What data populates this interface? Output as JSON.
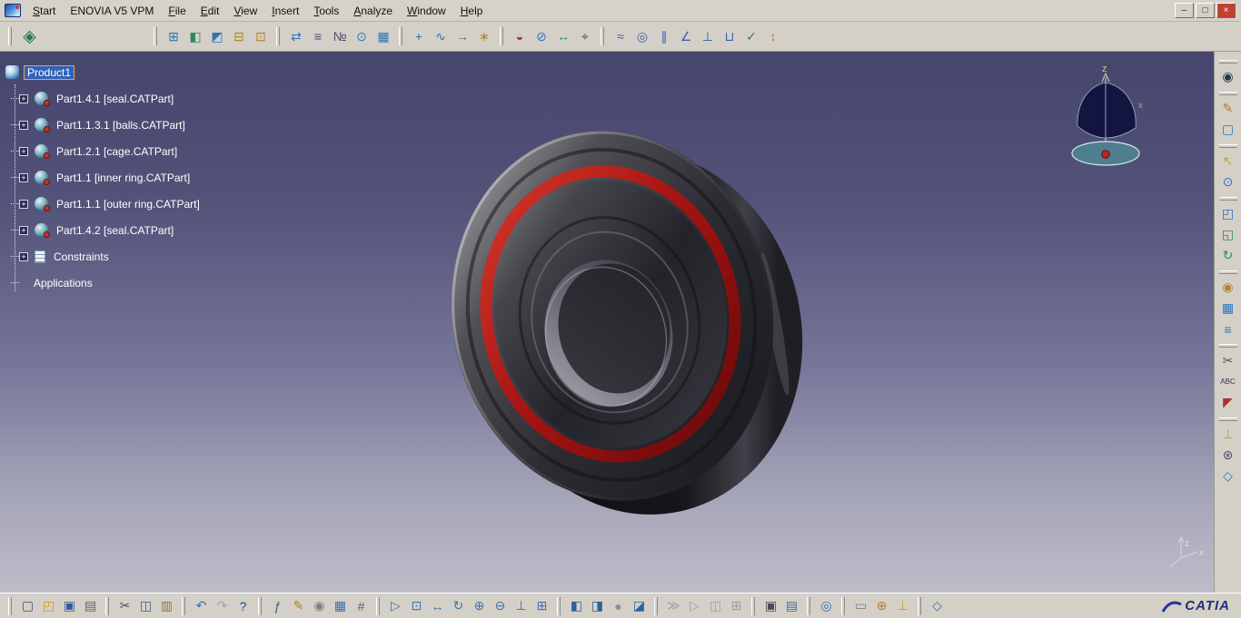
{
  "menubar": {
    "menus": [
      {
        "label": "Start",
        "u": 0
      },
      {
        "label": "ENOVIA V5 VPM",
        "u": -1
      },
      {
        "label": "File",
        "u": 0
      },
      {
        "label": "Edit",
        "u": 0
      },
      {
        "label": "View",
        "u": 0
      },
      {
        "label": "Insert",
        "u": 0
      },
      {
        "label": "Tools",
        "u": 0
      },
      {
        "label": "Analyze",
        "u": 0
      },
      {
        "label": "Window",
        "u": 0
      },
      {
        "label": "Help",
        "u": 0
      }
    ],
    "controls": [
      {
        "name": "minimize",
        "glyph": "–"
      },
      {
        "name": "restore",
        "glyph": "□"
      },
      {
        "name": "close",
        "glyph": "×"
      }
    ]
  },
  "toolbars": {
    "top": {
      "workbench": {
        "name": "assembly-design-workbench",
        "glyph": "◈",
        "color": "#2b7a4f"
      },
      "groups": [
        {
          "icons": [
            {
              "name": "new-component",
              "glyph": "⊞",
              "color": "#2e74b8"
            },
            {
              "name": "new-product",
              "glyph": "◧",
              "color": "#2e8b57"
            },
            {
              "name": "new-part",
              "glyph": "◩",
              "color": "#2e74b8"
            },
            {
              "name": "existing-component",
              "glyph": "⊟",
              "color": "#b5832a"
            },
            {
              "name": "existing-component-positioned",
              "glyph": "⊡",
              "color": "#b5832a"
            }
          ]
        },
        {
          "icons": [
            {
              "name": "replace-component",
              "glyph": "⇄",
              "color": "#2e74b8"
            },
            {
              "name": "graph-tree-reordering",
              "glyph": "≡",
              "color": "#44506a"
            },
            {
              "name": "generate-numbering",
              "glyph": "№",
              "color": "#44506a"
            },
            {
              "name": "selective-load",
              "glyph": "⊙",
              "color": "#2e74b8"
            },
            {
              "name": "manage-representations",
              "glyph": "▦",
              "color": "#2e74b8"
            }
          ]
        },
        {
          "icons": [
            {
              "name": "manipulation",
              "glyph": "+",
              "color": "#2e74b8"
            },
            {
              "name": "snap",
              "glyph": "∿",
              "color": "#2e74b8"
            },
            {
              "name": "smart-move",
              "glyph": "→",
              "color": "#2e8b57"
            },
            {
              "name": "explode",
              "glyph": "∗",
              "color": "#b5832a"
            }
          ]
        },
        {
          "icons": [
            {
              "name": "clash-analysis",
              "glyph": "◒",
              "color": "#b03030"
            },
            {
              "name": "sectioning",
              "glyph": "⊘",
              "color": "#2e74b8"
            },
            {
              "name": "distance-band-analysis",
              "glyph": "↔",
              "color": "#2e8b57"
            },
            {
              "name": "measure-between",
              "glyph": "⌖",
              "color": "#44506a"
            }
          ]
        },
        {
          "icons": [
            {
              "name": "coincidence-constraint",
              "glyph": "≈",
              "color": "#3a62a8"
            },
            {
              "name": "contact-constraint",
              "glyph": "◎",
              "color": "#3a62a8"
            },
            {
              "name": "offset-constraint",
              "glyph": "∥",
              "color": "#3a62a8"
            },
            {
              "name": "angle-constraint",
              "glyph": "∠",
              "color": "#3a62a8"
            },
            {
              "name": "fix-component",
              "glyph": "⊥",
              "color": "#3a62a8"
            },
            {
              "name": "fix-together",
              "glyph": "⊔",
              "color": "#3a62a8"
            },
            {
              "name": "quick-constraint",
              "glyph": "✓",
              "color": "#2e8b57"
            },
            {
              "name": "flexible-rigid-subassembly",
              "glyph": "↕",
              "color": "#b5832a"
            }
          ]
        }
      ]
    },
    "right": {
      "groups": [
        {
          "icons": [
            {
              "name": "examine-mode",
              "glyph": "◉",
              "color": "#27364a"
            }
          ]
        },
        {
          "icons": [
            {
              "name": "sketcher",
              "glyph": "✎",
              "color": "#b08020"
            },
            {
              "name": "new-sheet",
              "glyph": "▢",
              "color": "#2e74b8"
            }
          ]
        },
        {
          "icons": [
            {
              "name": "select",
              "glyph": "↖",
              "color": "#c8a020"
            },
            {
              "name": "zoom-part",
              "glyph": "⊙",
              "color": "#2e74b8"
            }
          ]
        },
        {
          "icons": [
            {
              "name": "open-in-new-window",
              "glyph": "◰",
              "color": "#2e74b8"
            },
            {
              "name": "publish",
              "glyph": "◱",
              "color": "#2e8b57"
            },
            {
              "name": "update-assembly",
              "glyph": "↻",
              "color": "#2e8b57"
            }
          ]
        },
        {
          "icons": [
            {
              "name": "manikin",
              "glyph": "◉",
              "color": "#b5832a"
            },
            {
              "name": "edit-table",
              "glyph": "▦",
              "color": "#2e74b8"
            },
            {
              "name": "edit-list",
              "glyph": "≡",
              "color": "#2e74b8"
            }
          ]
        },
        {
          "icons": [
            {
              "name": "section-cut",
              "glyph": "✂",
              "color": "#4a5668"
            },
            {
              "name": "text-annotation",
              "glyph": "ABC",
              "color": "#2f3e52"
            },
            {
              "name": "flag-note",
              "glyph": "◤",
              "color": "#b03030"
            }
          ]
        },
        {
          "icons": [
            {
              "name": "axis-system",
              "glyph": "⊥",
              "color": "#c8a020"
            },
            {
              "name": "tools-palette",
              "glyph": "⊛",
              "color": "#44506a"
            },
            {
              "name": "catalog",
              "glyph": "◇",
              "color": "#2e74b8"
            }
          ]
        }
      ]
    },
    "bottom": {
      "groups": [
        {
          "icons": [
            {
              "name": "new-document",
              "glyph": "▢",
              "color": "#3b4e6b"
            },
            {
              "name": "open",
              "glyph": "◰",
              "color": "#c79a2a"
            },
            {
              "name": "save",
              "glyph": "▣",
              "color": "#35589c"
            },
            {
              "name": "print",
              "glyph": "▤",
              "color": "#5a6572"
            }
          ]
        },
        {
          "icons": [
            {
              "name": "cut",
              "glyph": "✂",
              "color": "#4a5668"
            },
            {
              "name": "copy",
              "glyph": "◫",
              "color": "#3f5b87"
            },
            {
              "name": "paste",
              "glyph": "▥",
              "color": "#8a7a3a"
            }
          ]
        },
        {
          "icons": [
            {
              "name": "undo",
              "glyph": "↶",
              "color": "#2f6fbe"
            },
            {
              "name": "redo",
              "glyph": "↷",
              "color": "#9aa2ae"
            },
            {
              "name": "whats-this",
              "glyph": "?",
              "color": "#1f4e9c"
            }
          ]
        },
        {
          "icons": [
            {
              "name": "formula",
              "glyph": "ƒ",
              "color": "#1b6a9c"
            },
            {
              "name": "comment",
              "glyph": "✎",
              "color": "#b08020"
            },
            {
              "name": "rule",
              "glyph": "◉",
              "color": "#777f8a"
            },
            {
              "name": "design-table",
              "glyph": "▦",
              "color": "#3a6fae"
            },
            {
              "name": "structure-graph",
              "glyph": "#",
              "color": "#5c6673"
            }
          ]
        },
        {
          "icons": [
            {
              "name": "fly-through",
              "glyph": "▷",
              "color": "#3a72b5"
            },
            {
              "name": "fit-all-in",
              "glyph": "⊡",
              "color": "#3a72b5"
            },
            {
              "name": "pan",
              "glyph": "↔",
              "color": "#3a72b5"
            },
            {
              "name": "rotate",
              "glyph": "↻",
              "color": "#3a72b5"
            },
            {
              "name": "zoom-in",
              "glyph": "⊕",
              "color": "#3a72b5"
            },
            {
              "name": "zoom-out",
              "glyph": "⊖",
              "color": "#3a72b5"
            },
            {
              "name": "normal-view",
              "glyph": "⊥",
              "color": "#3a72b5"
            },
            {
              "name": "multi-view",
              "glyph": "⊞",
              "color": "#3a72b5"
            }
          ]
        },
        {
          "icons": [
            {
              "name": "isometric-view",
              "glyph": "◧",
              "color": "#2e5f9e"
            },
            {
              "name": "shading-mode",
              "glyph": "◨",
              "color": "#2e5f9e"
            },
            {
              "name": "light-effects",
              "glyph": "●",
              "color": "#8a8f98"
            },
            {
              "name": "hide-show",
              "glyph": "◪",
              "color": "#2e5f9e"
            }
          ]
        },
        {
          "icons": [
            {
              "name": "simulation-play",
              "glyph": "≫",
              "color": "#9aa0a8"
            },
            {
              "name": "step-forward",
              "glyph": "▷",
              "color": "#9aa0a8"
            },
            {
              "name": "capture-view",
              "glyph": "◫",
              "color": "#9aa0a8"
            },
            {
              "name": "grid-display",
              "glyph": "⊞",
              "color": "#9aa0a8"
            }
          ]
        },
        {
          "icons": [
            {
              "name": "render-capture",
              "glyph": "▣",
              "color": "#444c58"
            },
            {
              "name": "quick-print",
              "glyph": "▤",
              "color": "#3a6fae"
            }
          ]
        },
        {
          "icons": [
            {
              "name": "enovia-connect",
              "glyph": "◎",
              "color": "#3a6fae"
            }
          ]
        },
        {
          "icons": [
            {
              "name": "measure-item",
              "glyph": "▭",
              "color": "#7a8088"
            },
            {
              "name": "measure-between",
              "glyph": "⊕",
              "color": "#d07818"
            },
            {
              "name": "axis-system",
              "glyph": "⊥",
              "color": "#c8a020"
            }
          ]
        },
        {
          "icons": [
            {
              "name": "catalog-browser",
              "glyph": "◇",
              "color": "#3a72b5"
            }
          ]
        }
      ]
    }
  },
  "tree": {
    "rows": [
      {
        "label": "Product1",
        "type": "root",
        "plus": false,
        "selected": true
      },
      {
        "label": "Part1.4.1 [seal.CATPart]",
        "type": "part",
        "plus": true
      },
      {
        "label": "Part1.1.3.1 [balls.CATPart]",
        "type": "part",
        "plus": true
      },
      {
        "label": "Part1.2.1 [cage.CATPart]",
        "type": "part",
        "plus": true
      },
      {
        "label": "Part1.1 [inner ring.CATPart]",
        "type": "part",
        "plus": true
      },
      {
        "label": "Part1.1.1 [outer ring.CATPart]",
        "type": "part",
        "plus": true
      },
      {
        "label": "Part1.4.2 [seal.CATPart]",
        "type": "part",
        "plus": true
      },
      {
        "label": "Constraints",
        "type": "constraints",
        "plus": true
      },
      {
        "label": "Applications",
        "type": "applications",
        "plus": false
      }
    ]
  },
  "compass": {
    "z_label": "z",
    "x_label": "x"
  },
  "triad": {
    "z_label": "z",
    "x_label": "x"
  },
  "viewport": {
    "bg_top": "#45456d",
    "bg_bottom": "#bdbdc9",
    "selection_color": "#2e63b8",
    "seal_color": "#a81414"
  },
  "logo": {
    "text": "CATIA"
  }
}
